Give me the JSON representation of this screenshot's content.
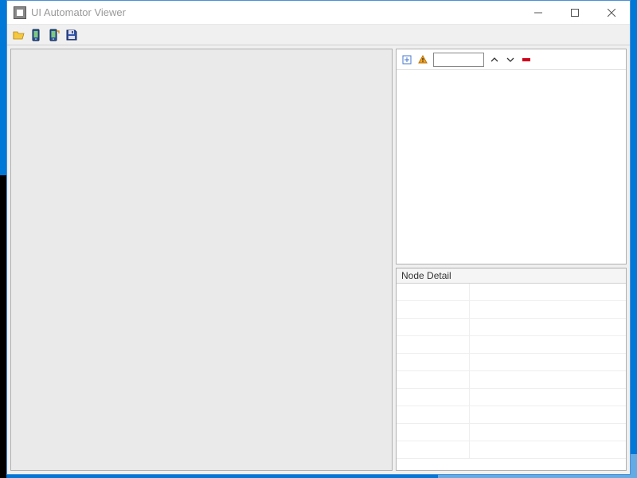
{
  "window": {
    "title": "UI Automator Viewer"
  },
  "toolbar": {
    "open_label": "Open",
    "screenshot_label": "Device Screenshot",
    "screenshot_compressed_label": "Device Screenshot (compressed)",
    "save_label": "Save"
  },
  "tree": {
    "expand_label": "Expand All",
    "warning_label": "Toggle NAF Nodes",
    "search_value": "",
    "prev_label": "Previous",
    "next_label": "Next",
    "clear_label": "Clear"
  },
  "detail": {
    "header": "Node Detail",
    "rows": [
      "",
      "",
      "",
      "",
      "",
      "",
      "",
      "",
      "",
      ""
    ]
  }
}
